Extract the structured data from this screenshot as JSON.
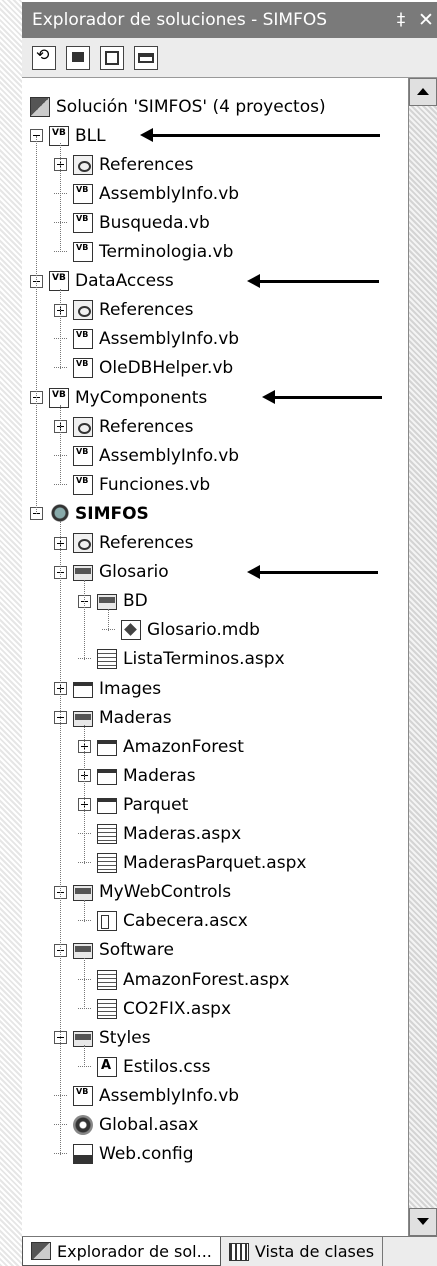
{
  "window": {
    "title": "Explorador de soluciones - SIMFOS",
    "pin_glyph": "‡",
    "close_glyph": "✕"
  },
  "toolbar": {
    "buttons": [
      "refresh-icon",
      "show-all-files-icon",
      "properties-icon",
      "view-code-icon"
    ]
  },
  "tree": [
    {
      "label": "Solución 'SIMFOS' (4 proyectos)",
      "icon": "solution-icon",
      "level": 0,
      "toggle": "none"
    },
    {
      "label": "BLL",
      "icon": "vb-project-icon",
      "level": 0,
      "toggle": "minus"
    },
    {
      "label": "References",
      "icon": "references-icon",
      "level": 1,
      "toggle": "plus"
    },
    {
      "label": "AssemblyInfo.vb",
      "icon": "vb-file-icon",
      "level": 1,
      "toggle": "none"
    },
    {
      "label": "Busqueda.vb",
      "icon": "vb-file-icon",
      "level": 1,
      "toggle": "none"
    },
    {
      "label": "Terminologia.vb",
      "icon": "vb-file-icon",
      "level": 1,
      "toggle": "none"
    },
    {
      "label": "DataAccess",
      "icon": "vb-project-icon",
      "level": 0,
      "toggle": "minus"
    },
    {
      "label": "References",
      "icon": "references-icon",
      "level": 1,
      "toggle": "plus"
    },
    {
      "label": "AssemblyInfo.vb",
      "icon": "vb-file-icon",
      "level": 1,
      "toggle": "none"
    },
    {
      "label": "OleDBHelper.vb",
      "icon": "vb-file-icon",
      "level": 1,
      "toggle": "none"
    },
    {
      "label": "MyComponents",
      "icon": "vb-project-icon",
      "level": 0,
      "toggle": "minus"
    },
    {
      "label": "References",
      "icon": "references-icon",
      "level": 1,
      "toggle": "plus"
    },
    {
      "label": "AssemblyInfo.vb",
      "icon": "vb-file-icon",
      "level": 1,
      "toggle": "none"
    },
    {
      "label": "Funciones.vb",
      "icon": "vb-file-icon",
      "level": 1,
      "toggle": "none"
    },
    {
      "label": "SIMFOS",
      "icon": "web-project-icon",
      "level": 0,
      "toggle": "minus",
      "bold": true
    },
    {
      "label": "References",
      "icon": "references-icon",
      "level": 1,
      "toggle": "plus"
    },
    {
      "label": "Glosario",
      "icon": "folder-open-icon",
      "level": 1,
      "toggle": "minus"
    },
    {
      "label": "BD",
      "icon": "folder-open-icon",
      "level": 2,
      "toggle": "minus"
    },
    {
      "label": "Glosario.mdb",
      "icon": "database-file-icon",
      "level": 3,
      "toggle": "none"
    },
    {
      "label": "ListaTerminos.aspx",
      "icon": "aspx-file-icon",
      "level": 2,
      "toggle": "none"
    },
    {
      "label": "Images",
      "icon": "folder-closed-icon",
      "level": 1,
      "toggle": "plus"
    },
    {
      "label": "Maderas",
      "icon": "folder-open-icon",
      "level": 1,
      "toggle": "minus"
    },
    {
      "label": "AmazonForest",
      "icon": "folder-closed-icon",
      "level": 2,
      "toggle": "plus"
    },
    {
      "label": "Maderas",
      "icon": "folder-closed-icon",
      "level": 2,
      "toggle": "plus"
    },
    {
      "label": "Parquet",
      "icon": "folder-closed-icon",
      "level": 2,
      "toggle": "plus"
    },
    {
      "label": "Maderas.aspx",
      "icon": "aspx-file-icon",
      "level": 2,
      "toggle": "none"
    },
    {
      "label": "MaderasParquet.aspx",
      "icon": "aspx-file-icon",
      "level": 2,
      "toggle": "none"
    },
    {
      "label": "MyWebControls",
      "icon": "folder-open-icon",
      "level": 1,
      "toggle": "minus"
    },
    {
      "label": "Cabecera.ascx",
      "icon": "ascx-file-icon",
      "level": 2,
      "toggle": "none"
    },
    {
      "label": "Software",
      "icon": "folder-open-icon",
      "level": 1,
      "toggle": "minus"
    },
    {
      "label": "AmazonForest.aspx",
      "icon": "aspx-file-icon",
      "level": 2,
      "toggle": "none"
    },
    {
      "label": "CO2FIX.aspx",
      "icon": "aspx-file-icon",
      "level": 2,
      "toggle": "none"
    },
    {
      "label": "Styles",
      "icon": "folder-open-icon",
      "level": 1,
      "toggle": "minus"
    },
    {
      "label": "Estilos.css",
      "icon": "css-file-icon",
      "level": 2,
      "toggle": "none"
    },
    {
      "label": "AssemblyInfo.vb",
      "icon": "vb-file-icon",
      "level": 1,
      "toggle": "none"
    },
    {
      "label": "Global.asax",
      "icon": "asax-file-icon",
      "level": 1,
      "toggle": "none"
    },
    {
      "label": "Web.config",
      "icon": "config-file-icon",
      "level": 1,
      "toggle": "none"
    }
  ],
  "tabs": [
    {
      "label": "Explorador de sol...",
      "icon": "solution-explorer-icon",
      "active": true
    },
    {
      "label": "Vista de clases",
      "icon": "class-view-icon",
      "active": false
    }
  ]
}
